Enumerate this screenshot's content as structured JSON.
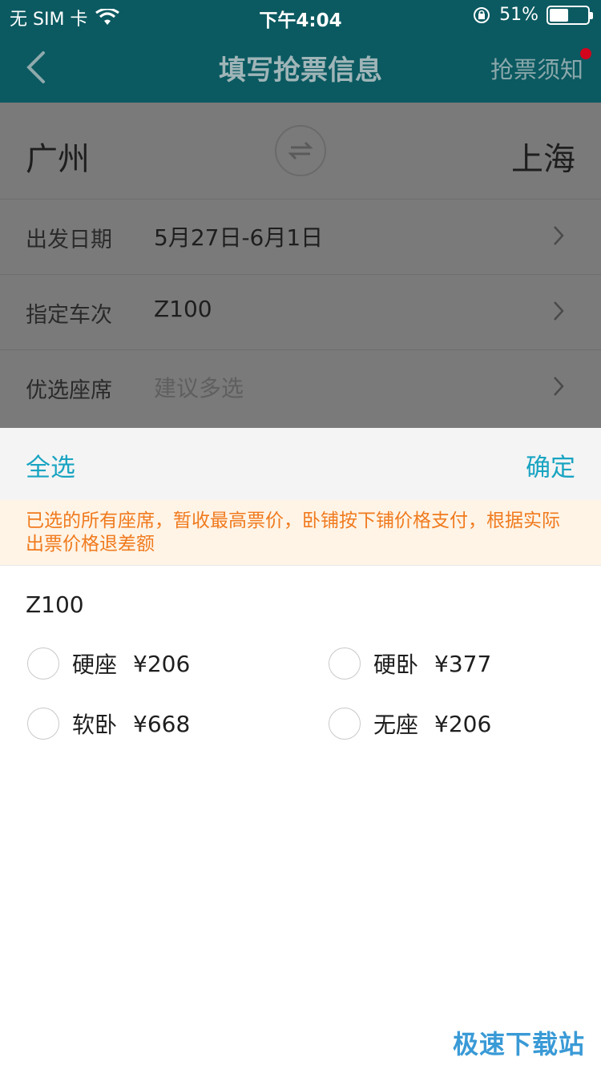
{
  "status_bar": {
    "carrier": "无 SIM 卡",
    "time": "下午4:04",
    "battery": "51%",
    "battery_level": 0.51,
    "icons": [
      "wifi-icon",
      "rotation-lock-icon",
      "battery-icon"
    ]
  },
  "nav": {
    "title": "填写抢票信息",
    "right_label": "抢票须知",
    "back_icon": "chevron-left-icon"
  },
  "route": {
    "from": "广州",
    "to": "上海",
    "swap_icon": "swap-icon"
  },
  "form": {
    "rows": [
      {
        "label": "出发日期",
        "value": "5月27日-6月1日"
      },
      {
        "label": "指定车次",
        "value": "Z100"
      },
      {
        "label": "优选座席",
        "placeholder": "建议多选"
      }
    ]
  },
  "sheet": {
    "select_all": "全选",
    "confirm": "确定",
    "notice": "已选的所有座席，暂收最高票价，卧铺按下铺价格支付，根据实际出票价格退差额",
    "train": "Z100",
    "seats": [
      {
        "name": "硬座",
        "price": "¥206"
      },
      {
        "name": "硬卧",
        "price": "¥377"
      },
      {
        "name": "软卧",
        "price": "¥668"
      },
      {
        "name": "无座",
        "price": "¥206"
      }
    ]
  },
  "watermark": "极速下载站",
  "colors": {
    "nav_bg_dimmed": "#0b5a61",
    "accent": "#19a4c2",
    "notice_text": "#f07a1e",
    "notice_bg": "#fff4e6",
    "badge": "#d3051d"
  }
}
